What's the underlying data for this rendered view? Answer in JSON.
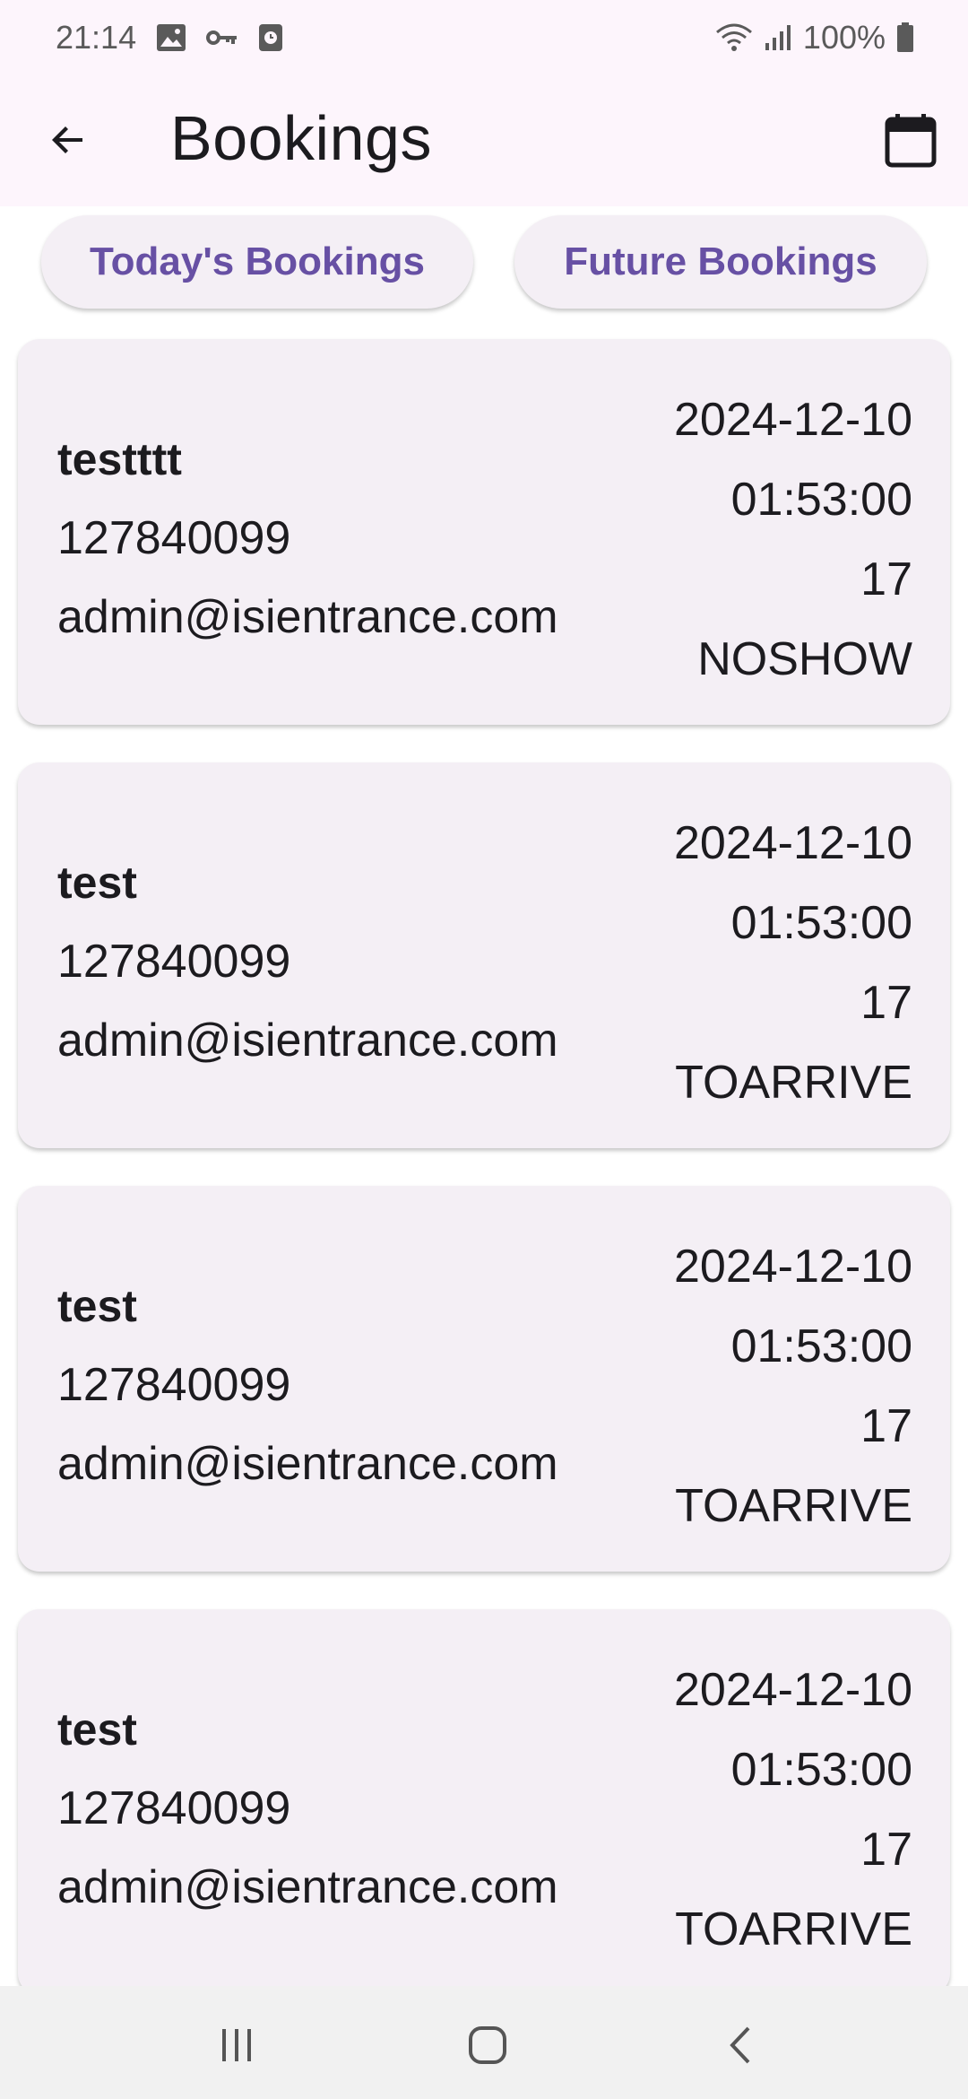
{
  "status_bar": {
    "time": "21:14",
    "battery": "100%",
    "icons_left": [
      "image-icon",
      "key-icon",
      "clock-icon"
    ],
    "icons_right": [
      "wifi-icon",
      "signal-icon",
      "battery-icon"
    ]
  },
  "app_bar": {
    "title": "Bookings",
    "back_icon": "arrow-back-icon",
    "action_icon": "calendar-icon"
  },
  "tabs": {
    "today": "Today's Bookings",
    "future": "Future Bookings"
  },
  "bookings": [
    {
      "name": "testttt",
      "phone": "127840099",
      "email": "admin@isientrance.com",
      "date": "2024-12-10",
      "time": "01:53:00",
      "count": "17",
      "status": "NOSHOW"
    },
    {
      "name": "test",
      "phone": "127840099",
      "email": "admin@isientrance.com",
      "date": "2024-12-10",
      "time": "01:53:00",
      "count": "17",
      "status": "TOARRIVE"
    },
    {
      "name": "test",
      "phone": "127840099",
      "email": "admin@isientrance.com",
      "date": "2024-12-10",
      "time": "01:53:00",
      "count": "17",
      "status": "TOARRIVE"
    },
    {
      "name": "test",
      "phone": "127840099",
      "email": "admin@isientrance.com",
      "date": "2024-12-10",
      "time": "01:53:00",
      "count": "17",
      "status": "TOARRIVE"
    }
  ],
  "colors": {
    "accent": "#6750a4",
    "app_bar_bg": "#fdf5fc",
    "card_bg": "#f4eff5",
    "text": "#1c1b1f"
  },
  "nav_bar": {
    "icons": [
      "recent-apps-icon",
      "home-icon",
      "back-nav-icon"
    ]
  }
}
